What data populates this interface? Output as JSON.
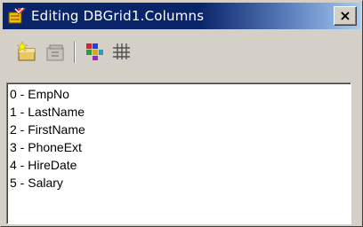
{
  "window": {
    "title": "Editing DBGrid1.Columns",
    "close_label": "×"
  },
  "toolbar": {
    "buttons": [
      {
        "name": "add-new-button",
        "icon": "add-new-icon",
        "enabled": true
      },
      {
        "name": "add-all-fields-button",
        "icon": "add-all-fields-icon",
        "enabled": false
      },
      {
        "name": "restore-defaults-button",
        "icon": "restore-defaults-icon",
        "enabled": true
      },
      {
        "name": "grid-button",
        "icon": "grid-icon",
        "enabled": true
      }
    ]
  },
  "columns": [
    {
      "label": "0 - EmpNo"
    },
    {
      "label": "1 - LastName"
    },
    {
      "label": "2 - FirstName"
    },
    {
      "label": "3 - PhoneExt"
    },
    {
      "label": "4 - HireDate"
    },
    {
      "label": "5 - Salary"
    }
  ],
  "colors": {
    "title_active": "#0a246a",
    "face": "#d4d0c8"
  }
}
